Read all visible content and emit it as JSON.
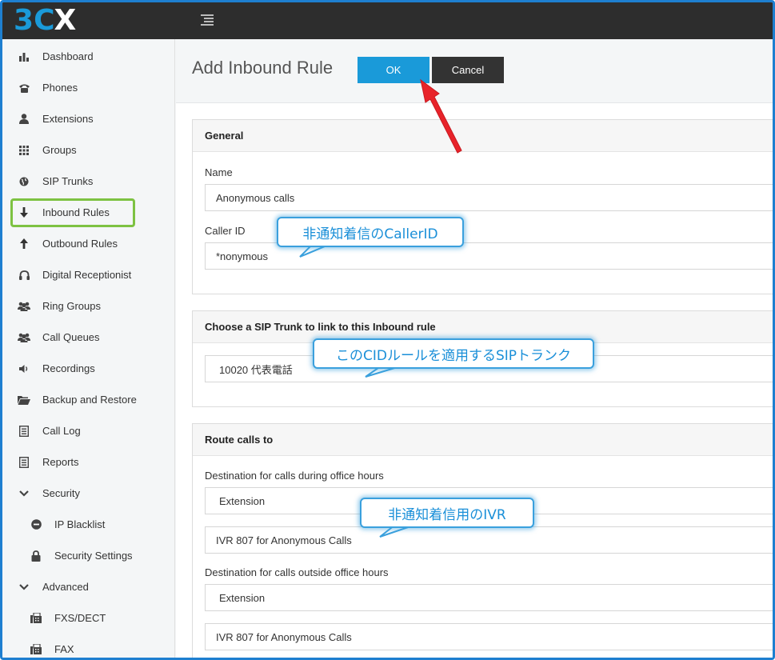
{
  "app": {
    "logo_3": "3",
    "logo_c": "C",
    "logo_x": "X"
  },
  "sidebar": {
    "items": [
      {
        "label": "Dashboard",
        "icon": "bar-chart-icon"
      },
      {
        "label": "Phones",
        "icon": "phone-icon"
      },
      {
        "label": "Extensions",
        "icon": "user-icon"
      },
      {
        "label": "Groups",
        "icon": "grid-icon"
      },
      {
        "label": "SIP Trunks",
        "icon": "globe-icon"
      },
      {
        "label": "Inbound Rules",
        "icon": "arrow-down-icon"
      },
      {
        "label": "Outbound Rules",
        "icon": "arrow-up-icon"
      },
      {
        "label": "Digital Receptionist",
        "icon": "headset-icon"
      },
      {
        "label": "Ring Groups",
        "icon": "users-icon"
      },
      {
        "label": "Call Queues",
        "icon": "users-icon"
      },
      {
        "label": "Recordings",
        "icon": "speaker-icon"
      },
      {
        "label": "Backup and Restore",
        "icon": "folder-icon"
      },
      {
        "label": "Call Log",
        "icon": "list-icon"
      },
      {
        "label": "Reports",
        "icon": "list-icon"
      },
      {
        "label": "Security",
        "icon": "chevron-down-icon"
      },
      {
        "label": "IP Blacklist",
        "icon": "minus-circle-icon"
      },
      {
        "label": "Security Settings",
        "icon": "lock-icon"
      },
      {
        "label": "Advanced",
        "icon": "chevron-down-icon"
      },
      {
        "label": "FXS/DECT",
        "icon": "fax-icon"
      },
      {
        "label": "FAX",
        "icon": "fax-icon"
      }
    ]
  },
  "header": {
    "title": "Add Inbound Rule",
    "ok_label": "OK",
    "cancel_label": "Cancel"
  },
  "general": {
    "title": "General",
    "name_label": "Name",
    "name_value": "Anonymous calls",
    "callerid_label": "Caller ID",
    "callerid_value": "*nonymous"
  },
  "trunk": {
    "title": "Choose a SIP Trunk to link to this Inbound rule",
    "value": "10020 代表電話"
  },
  "route": {
    "title": "Route calls to",
    "office_label": "Destination for calls during office hours",
    "office_type": "Extension",
    "office_value": "IVR 807 for Anonymous Calls",
    "outside_label": "Destination for calls outside office hours",
    "outside_type": "Extension",
    "outside_value": "IVR 807 for Anonymous Calls"
  },
  "callouts": {
    "callerid_note": "非通知着信のCallerID",
    "trunk_note": "このCIDルールを適用するSIPトランク",
    "ivr_note": "非通知着信用のIVR"
  },
  "colors": {
    "accent": "#1a9ad9",
    "highlight": "#7dc242",
    "arrow": "#e8232a"
  }
}
